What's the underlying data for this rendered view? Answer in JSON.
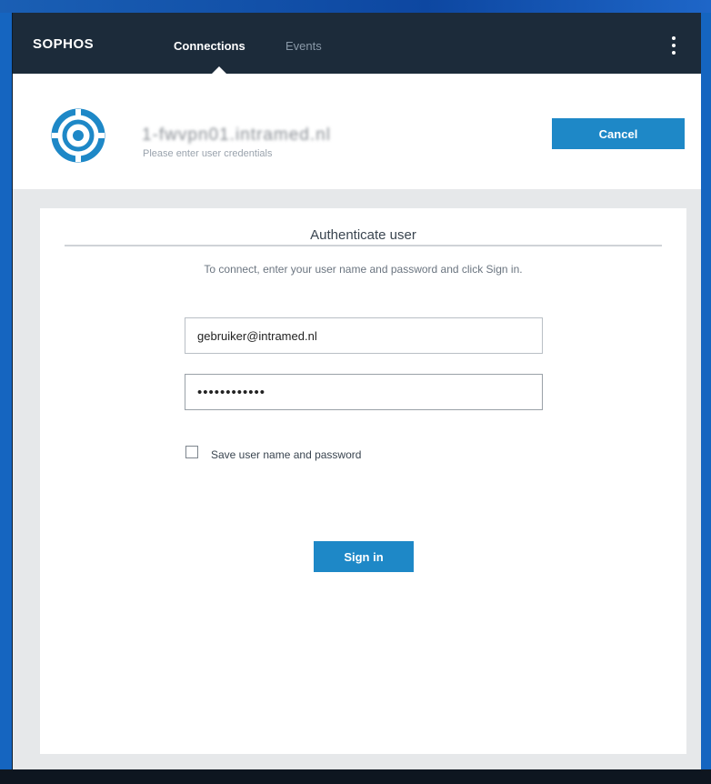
{
  "app": {
    "brand": "SOPHOS"
  },
  "nav": {
    "tabs": [
      {
        "label": "Connections",
        "active": true
      },
      {
        "label": "Events",
        "active": false
      }
    ]
  },
  "connection": {
    "name": "1-fwvpn01.intramed.nl",
    "subtitle": "Please enter user credentials",
    "cancel_label": "Cancel"
  },
  "auth": {
    "title": "Authenticate user",
    "instructions": "To connect, enter your user name and password and click Sign in.",
    "username_value": "gebruiker@intramed.nl",
    "password_value": "••••••••••••",
    "save_credentials_label": "Save user name and password",
    "save_credentials_checked": false,
    "signin_label": "Sign in"
  },
  "colors": {
    "topbar": "#1c2b3a",
    "accent": "#1e88c7",
    "logo": "#1e88c7"
  }
}
